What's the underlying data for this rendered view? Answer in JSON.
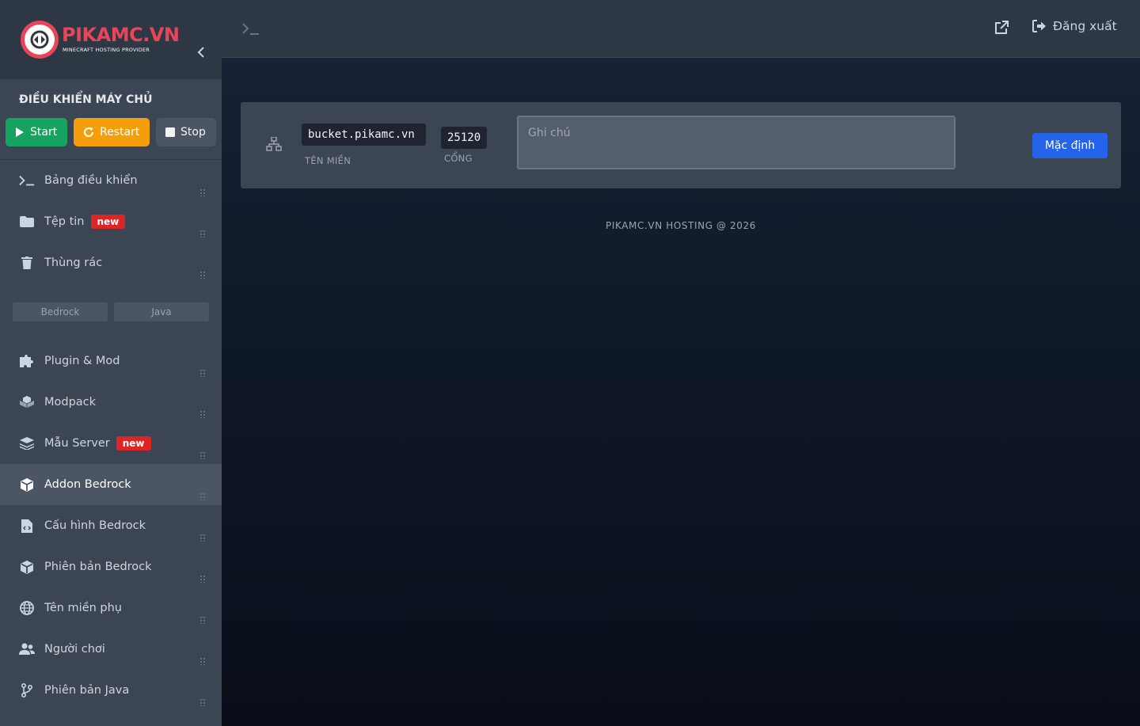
{
  "brand": {
    "name": "PIKAMC.VN",
    "tagline": "MINECRAFT HOSTING PROVIDER",
    "accent_color": "#e8445a"
  },
  "server_control": {
    "title": "ĐIỀU KHIỂN MÁY CHỦ",
    "start_label": "Start",
    "restart_label": "Restart",
    "stop_label": "Stop"
  },
  "sidebar": {
    "items": [
      {
        "label": "Bảng điều khiển",
        "icon": "terminal-icon"
      },
      {
        "label": "Tệp tin",
        "icon": "folder-icon",
        "badge": "new"
      },
      {
        "label": "Thùng rác",
        "icon": "trash-icon"
      },
      {
        "label": "Plugin & Mod",
        "icon": "puzzle-icon"
      },
      {
        "label": "Modpack",
        "icon": "cubes-icon"
      },
      {
        "label": "Mẫu Server",
        "icon": "layers-icon",
        "badge": "new"
      },
      {
        "label": "Addon Bedrock",
        "icon": "cube-icon",
        "active": true
      },
      {
        "label": "Cấu hình Bedrock",
        "icon": "config-file-icon"
      },
      {
        "label": "Phiên bản Bedrock",
        "icon": "box-icon"
      },
      {
        "label": "Tên miền phụ",
        "icon": "globe-icon"
      },
      {
        "label": "Người chơi",
        "icon": "users-icon"
      },
      {
        "label": "Phiên bản Java",
        "icon": "branch-icon"
      }
    ],
    "edition_tabs": [
      "Bedrock",
      "Java"
    ]
  },
  "topbar": {
    "logout_label": "Đăng xuất"
  },
  "allocation": {
    "domain": "bucket.pikamc.vn",
    "domain_label": "TÊN MIỀN",
    "port": "25120",
    "port_label": "CỔNG",
    "note_placeholder": "Ghi chú",
    "default_button": "Mặc định"
  },
  "footer": {
    "text": "PIKAMC.VN HOSTING @ 2026"
  }
}
